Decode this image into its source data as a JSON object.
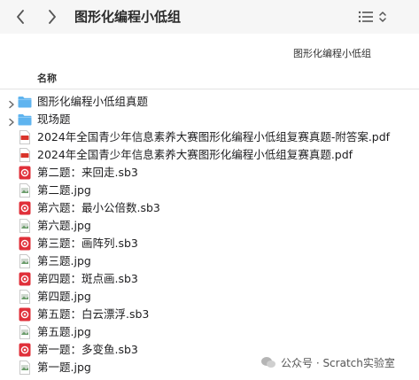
{
  "window": {
    "title": "图形化编程小低组"
  },
  "toolbar": {
    "back_icon": "chevron-left-icon",
    "forward_icon": "chevron-right-icon",
    "view_icon": "list-view-icon"
  },
  "path": {
    "label": "图形化编程小低组"
  },
  "columns": {
    "name": "名称"
  },
  "colors": {
    "folder": "#5fb4ef",
    "pdf": "#d9342b",
    "sb3": "#e0303a"
  },
  "items": [
    {
      "label": "图形化编程小低组真题",
      "type": "folder"
    },
    {
      "label": "现场题",
      "type": "folder"
    },
    {
      "label": "2024年全国青少年信息素养大赛图形化编程小低组复赛真题-附答案.pdf",
      "type": "pdf"
    },
    {
      "label": "2024年全国青少年信息素养大赛图形化编程小低组复赛真题.pdf",
      "type": "pdf"
    },
    {
      "label": "第二题：来回走.sb3",
      "type": "sb3"
    },
    {
      "label": "第二题.jpg",
      "type": "jpg"
    },
    {
      "label": "第六题：最小公倍数.sb3",
      "type": "sb3"
    },
    {
      "label": "第六题.jpg",
      "type": "jpg"
    },
    {
      "label": "第三题：画阵列.sb3",
      "type": "sb3"
    },
    {
      "label": "第三题.jpg",
      "type": "jpg"
    },
    {
      "label": "第四题：斑点画.sb3",
      "type": "sb3"
    },
    {
      "label": "第四题.jpg",
      "type": "jpg"
    },
    {
      "label": "第五题：白云漂浮.sb3",
      "type": "sb3"
    },
    {
      "label": "第五题.jpg",
      "type": "jpg"
    },
    {
      "label": "第一题：多变鱼.sb3",
      "type": "sb3"
    },
    {
      "label": "第一题.jpg",
      "type": "jpg"
    }
  ],
  "watermark": {
    "text": "公众号 · Scratch实验室"
  }
}
